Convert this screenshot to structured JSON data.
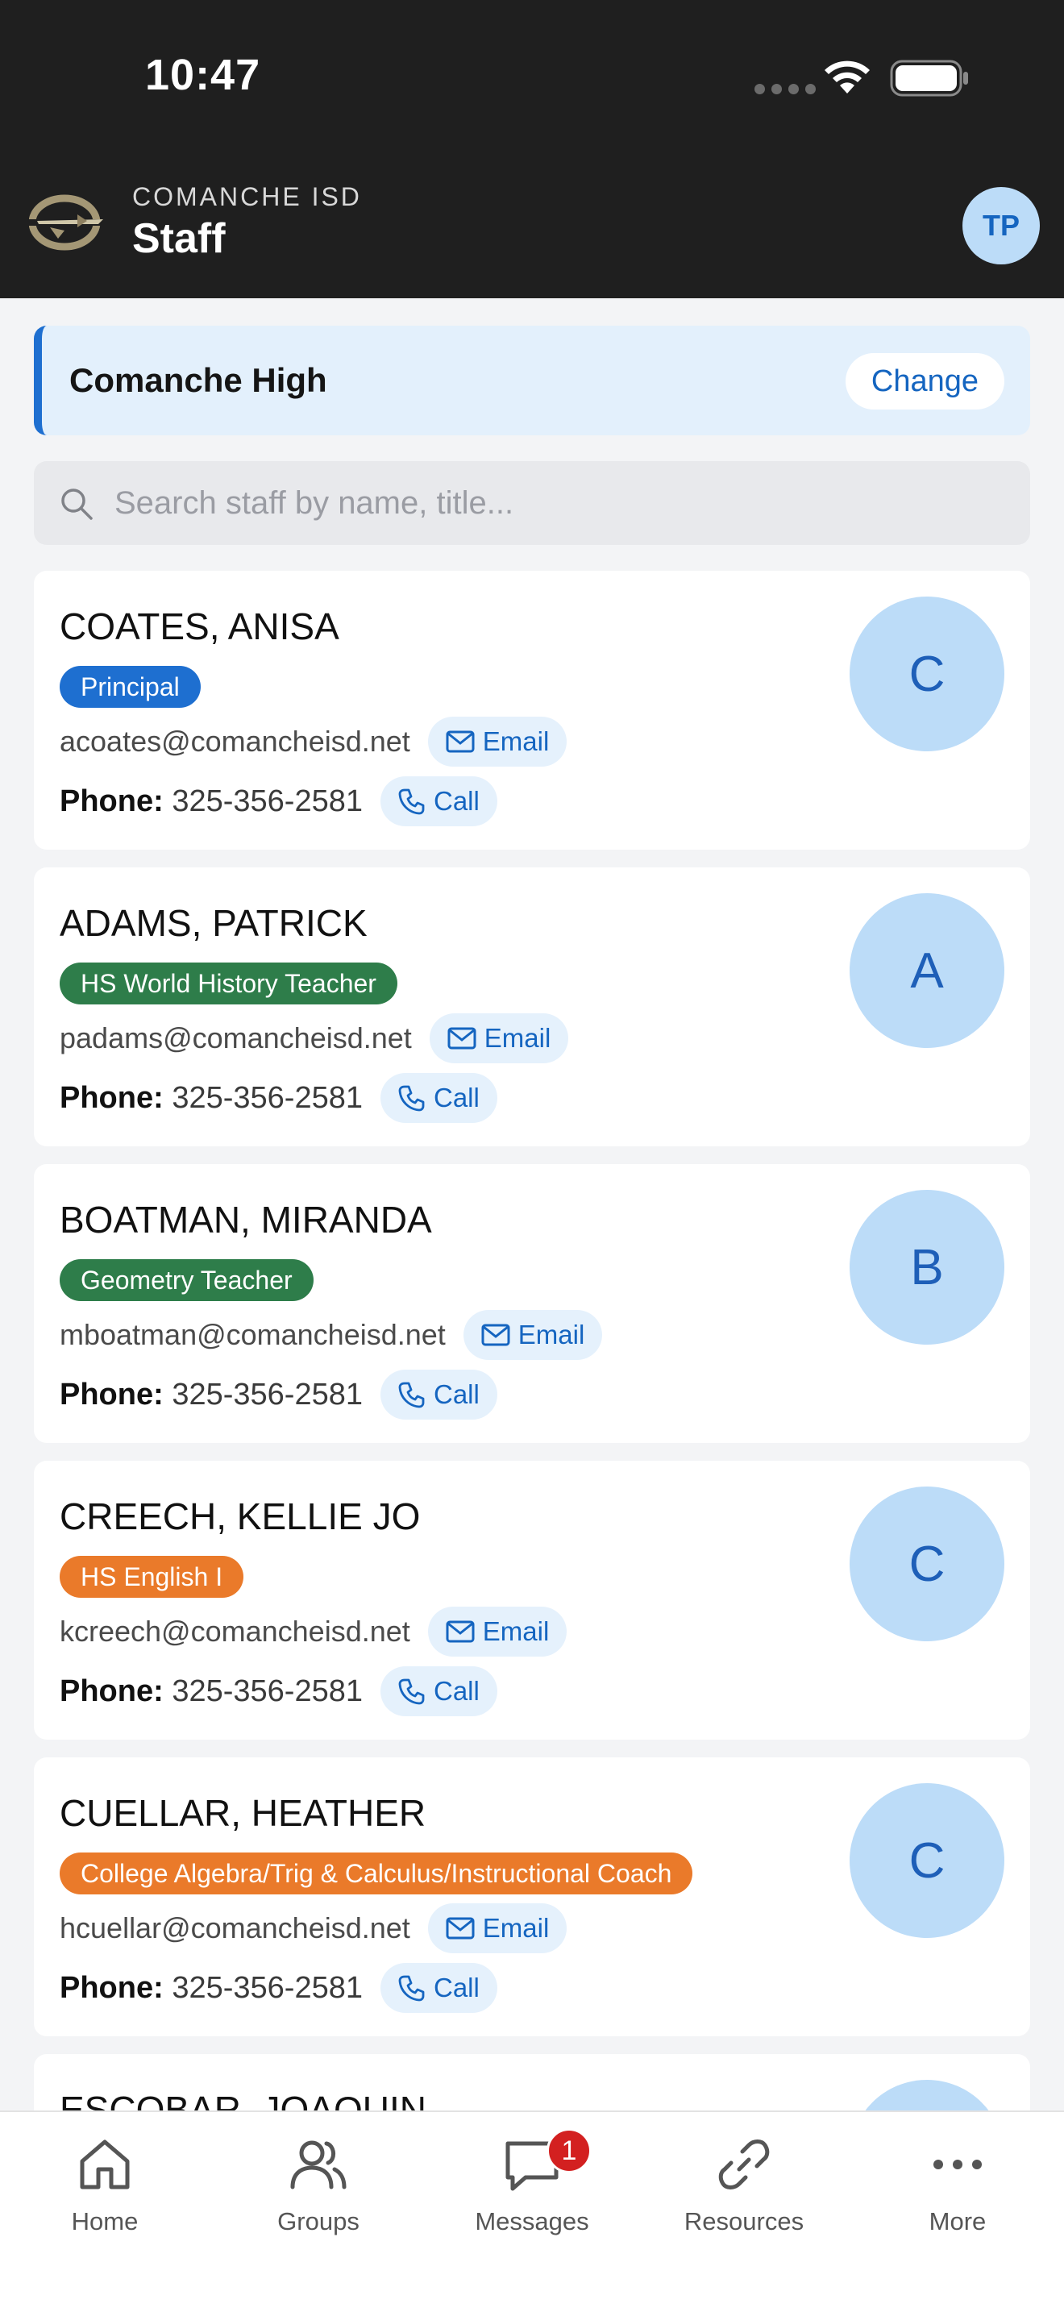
{
  "status_bar": {
    "time": "10:47"
  },
  "header": {
    "org": "COMANCHE ISD",
    "title": "Staff",
    "user_initials": "TP"
  },
  "school": {
    "name": "Comanche High",
    "change_label": "Change"
  },
  "search": {
    "placeholder": "Search staff by name, title..."
  },
  "labels": {
    "phone": "Phone:",
    "email_button": "Email",
    "call_button": "Call"
  },
  "staff": [
    {
      "name": "COATES, ANISA",
      "role": "Principal",
      "role_color": "#1e6fd0",
      "email": "acoates@comancheisd.net",
      "phone": "325-356-2581",
      "initial": "C"
    },
    {
      "name": "ADAMS, PATRICK",
      "role": "HS World History Teacher",
      "role_color": "#2e7d4a",
      "email": "padams@comancheisd.net",
      "phone": "325-356-2581",
      "initial": "A"
    },
    {
      "name": "BOATMAN, MIRANDA",
      "role": "Geometry Teacher",
      "role_color": "#2e7d4a",
      "email": "mboatman@comancheisd.net",
      "phone": "325-356-2581",
      "initial": "B"
    },
    {
      "name": "CREECH, KELLIE JO",
      "role": "HS English I",
      "role_color": "#ea7a2a",
      "email": "kcreech@comancheisd.net",
      "phone": "325-356-2581",
      "initial": "C"
    },
    {
      "name": "CUELLAR, HEATHER",
      "role": "College Algebra/Trig & Calculus/Instructional Coach",
      "role_color": "#ea7a2a",
      "email": "hcuellar@comancheisd.net",
      "phone": "325-356-2581",
      "initial": "C"
    },
    {
      "name": "ESCOBAR, JOAQUIN",
      "initial": ""
    }
  ],
  "tabbar": {
    "items": [
      {
        "label": "Home",
        "icon": "home-icon"
      },
      {
        "label": "Groups",
        "icon": "groups-icon"
      },
      {
        "label": "Messages",
        "icon": "messages-icon",
        "badge": "1"
      },
      {
        "label": "Resources",
        "icon": "link-icon"
      },
      {
        "label": "More",
        "icon": "more-icon"
      }
    ]
  }
}
